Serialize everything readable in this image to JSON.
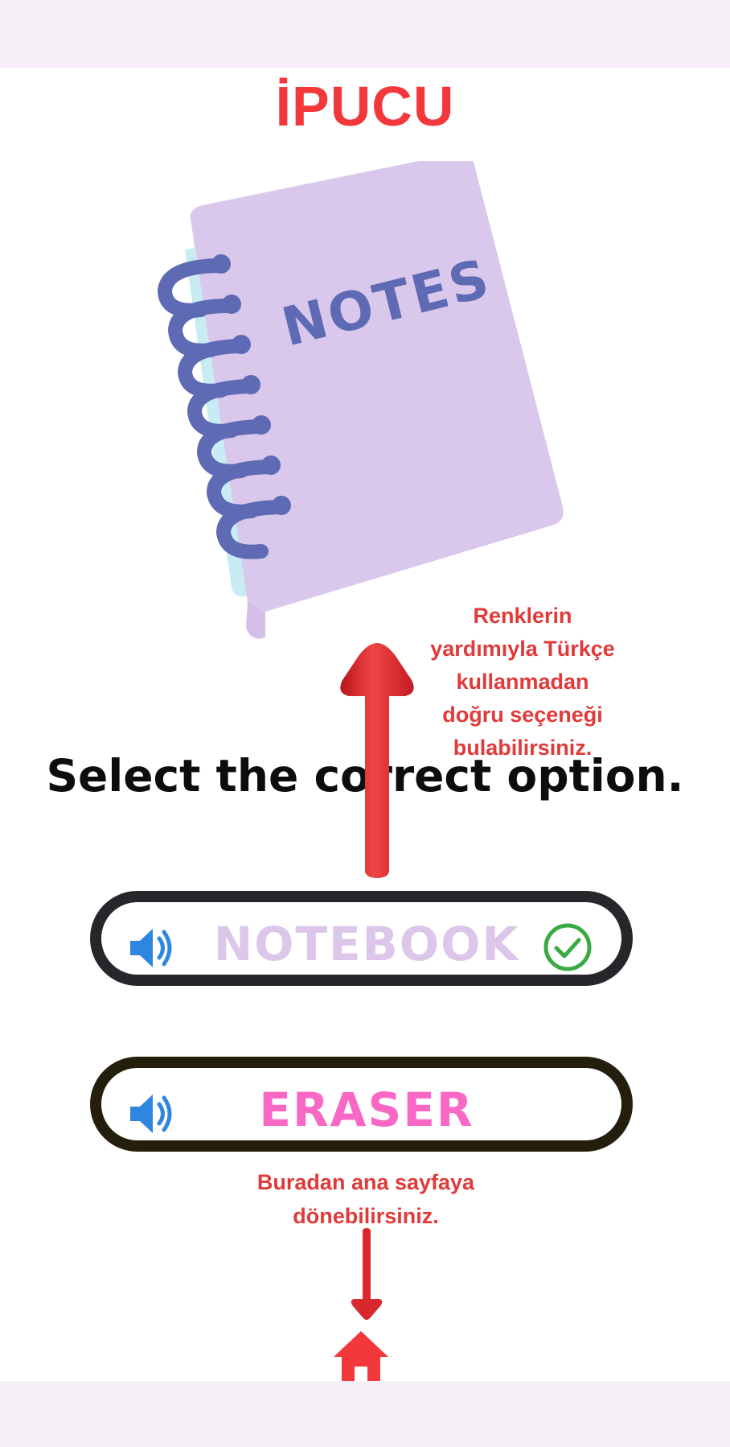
{
  "header": {
    "title": "İPUCU"
  },
  "illustration": {
    "notebook_text": "NOTES",
    "icon": "notebook-illustration"
  },
  "hints": {
    "colors_lines": [
      "Renklerin",
      "yardımıyla Türkçe",
      "kullanmadan",
      "doğru seçeneği",
      "bulabilirsiniz."
    ],
    "home_lines": [
      "Buradan ana sayfaya",
      "dönebilirsiniz."
    ]
  },
  "question": "Select the correct option.",
  "options": [
    {
      "label": "NOTEBOOK",
      "state": "correct",
      "speaker_icon": "speaker-icon",
      "status_icon": "check-circle-icon"
    },
    {
      "label": "ERASER",
      "speaker_icon": "speaker-icon"
    }
  ],
  "navigation": {
    "home_icon": "home-icon"
  },
  "colors": {
    "accent_red": "#f2383a",
    "hint_red": "#e03a3a",
    "notebook_purple": "#dcc6ea",
    "eraser_pink": "#f968c4",
    "speaker_blue": "#2f86e0",
    "check_green": "#3aaa45",
    "bar_bg": "#f7eff7"
  }
}
